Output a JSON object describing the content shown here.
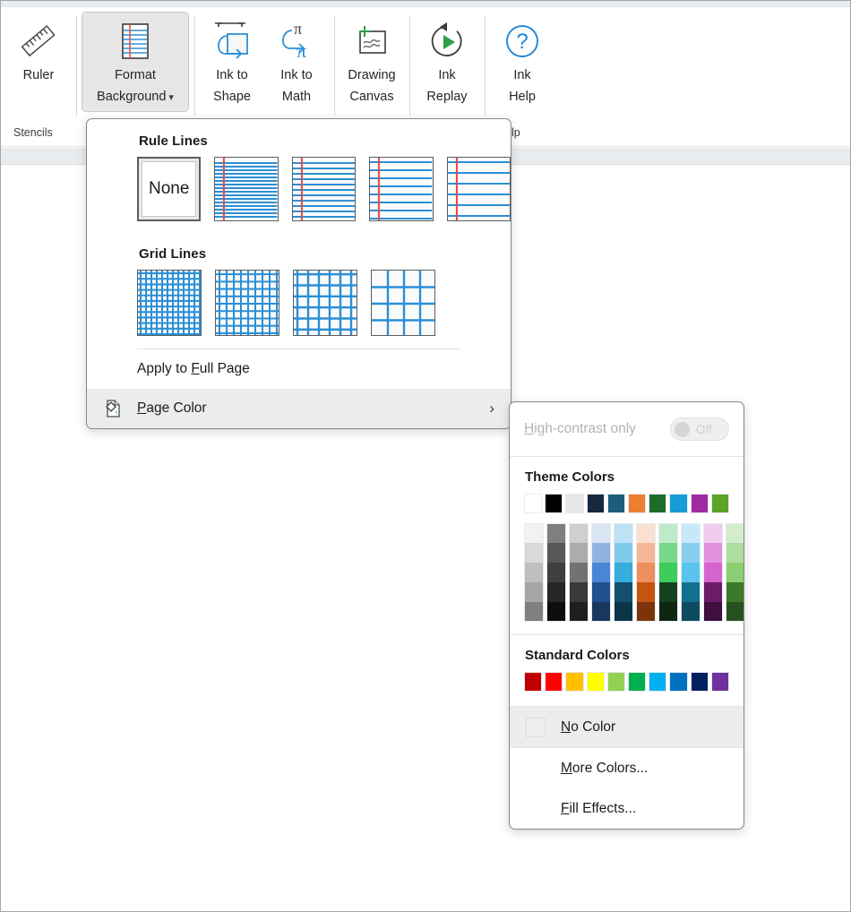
{
  "ribbon": {
    "groups": [
      {
        "name": "stencils",
        "label": "Stencils",
        "buttons": [
          {
            "id": "ruler",
            "icon": "ruler-icon",
            "line1": "Ruler",
            "line2": "",
            "active": false,
            "chevron": false
          }
        ]
      },
      {
        "name": "background",
        "label": "",
        "buttons": [
          {
            "id": "format-background",
            "icon": "ruled-paper-icon",
            "line1": "Format",
            "line2": "Background",
            "active": true,
            "chevron": true
          }
        ]
      },
      {
        "name": "convert",
        "label": "",
        "buttons": [
          {
            "id": "ink-to-shape",
            "icon": "ink-to-shape-icon",
            "line1": "Ink to",
            "line2": "Shape",
            "active": false,
            "chevron": false
          },
          {
            "id": "ink-to-math",
            "icon": "ink-to-math-icon",
            "line1": "Ink to",
            "line2": "Math",
            "active": false,
            "chevron": false
          }
        ]
      },
      {
        "name": "canvas",
        "label": "",
        "buttons": [
          {
            "id": "drawing-canvas",
            "icon": "drawing-canvas-icon",
            "line1": "Drawing",
            "line2": "Canvas",
            "active": false,
            "chevron": false
          }
        ]
      },
      {
        "name": "replay",
        "label": "",
        "buttons": [
          {
            "id": "ink-replay",
            "icon": "ink-replay-icon",
            "line1": "Ink",
            "line2": "Replay",
            "active": false,
            "chevron": false
          }
        ]
      },
      {
        "name": "help",
        "label": "Help",
        "buttons": [
          {
            "id": "ink-help",
            "icon": "question-circle-icon",
            "line1": "Ink",
            "line2": "Help",
            "active": false,
            "chevron": false
          }
        ]
      }
    ]
  },
  "format_background_menu": {
    "rule_lines": {
      "title": "Rule Lines",
      "options": [
        {
          "id": "none",
          "label": "None",
          "type": "none",
          "selected": true
        },
        {
          "id": "narrow-ruled",
          "label": "",
          "type": "ruled",
          "lines": 16,
          "selected": false
        },
        {
          "id": "college-ruled",
          "label": "",
          "type": "ruled",
          "lines": 11,
          "selected": false
        },
        {
          "id": "standard-ruled",
          "label": "",
          "type": "ruled",
          "lines": 8,
          "selected": false
        },
        {
          "id": "wide-ruled",
          "label": "",
          "type": "ruled",
          "lines": 6,
          "selected": false
        }
      ]
    },
    "grid_lines": {
      "title": "Grid Lines",
      "options": [
        {
          "id": "small-grid",
          "label": "",
          "type": "grid",
          "cells": 11,
          "selected": false
        },
        {
          "id": "medium-grid",
          "label": "",
          "type": "grid",
          "cells": 9,
          "selected": false
        },
        {
          "id": "large-grid",
          "label": "",
          "type": "grid",
          "cells": 6,
          "selected": false
        },
        {
          "id": "very-large-grid",
          "label": "",
          "type": "grid",
          "cells": 4,
          "selected": false
        }
      ]
    },
    "items": [
      {
        "id": "apply-to-full-page",
        "label": "Apply to Full Page",
        "accel": "F",
        "icon": "",
        "submenu": false,
        "highlighted": false
      },
      {
        "id": "page-color",
        "label": "Page Color",
        "accel": "P",
        "icon": "page-color-icon",
        "submenu": true,
        "highlighted": true
      }
    ],
    "submenu_arrow": "›"
  },
  "page_color_menu": {
    "high_contrast": {
      "label": "High-contrast only",
      "accel": "H",
      "state": "Off",
      "enabled": false
    },
    "theme": {
      "title": "Theme Colors",
      "base": [
        "#ffffff",
        "#000000",
        "#e7e6e6",
        "#15293f",
        "#1f5c7d",
        "#ed7d31",
        "#1e6b2a",
        "#179bd7",
        "#a02ba0",
        "#5aa529"
      ],
      "shades": [
        [
          "#f2f2f2",
          "#d9d9d9",
          "#bfbfbf",
          "#a6a6a6",
          "#808080"
        ],
        [
          "#7f7f7f",
          "#595959",
          "#3f3f3f",
          "#262626",
          "#0d0d0d"
        ],
        [
          "#d0cece",
          "#afabab",
          "#757171",
          "#3b3838",
          "#201f1e"
        ],
        [
          "#d9e5f3",
          "#8fb4e3",
          "#4a86d4",
          "#20528f",
          "#18365e"
        ],
        [
          "#bde2f5",
          "#7fcbec",
          "#35aede",
          "#14506e",
          "#0d3549"
        ],
        [
          "#fbe0d2",
          "#f4b896",
          "#ef8f5d",
          "#c5540e",
          "#7d340a"
        ],
        [
          "#bfeac7",
          "#78d88a",
          "#3fcc5c",
          "#17421f",
          "#0d2713"
        ],
        [
          "#c6e9f9",
          "#88cfef",
          "#5bc4ee",
          "#14708f",
          "#0d4b61"
        ],
        [
          "#f0cdee",
          "#e391de",
          "#d664cd",
          "#6b1c68",
          "#3f0f3e"
        ],
        [
          "#d4eccb",
          "#aedd9c",
          "#8ace71",
          "#3b7a2a",
          "#27511c"
        ]
      ]
    },
    "standard": {
      "title": "Standard Colors",
      "colors": [
        "#c00000",
        "#ff0000",
        "#ffc000",
        "#ffff00",
        "#92d050",
        "#00b050",
        "#00b0f0",
        "#0070c0",
        "#002060",
        "#7030a0"
      ]
    },
    "items": [
      {
        "id": "no-color",
        "label": "No Color",
        "accel": "N",
        "swatch": true,
        "highlighted": true
      },
      {
        "id": "more-colors",
        "label": "More Colors...",
        "accel": "M",
        "swatch": false,
        "highlighted": false
      },
      {
        "id": "fill-effects",
        "label": "Fill Effects...",
        "accel": "F",
        "swatch": false,
        "highlighted": false
      }
    ]
  }
}
